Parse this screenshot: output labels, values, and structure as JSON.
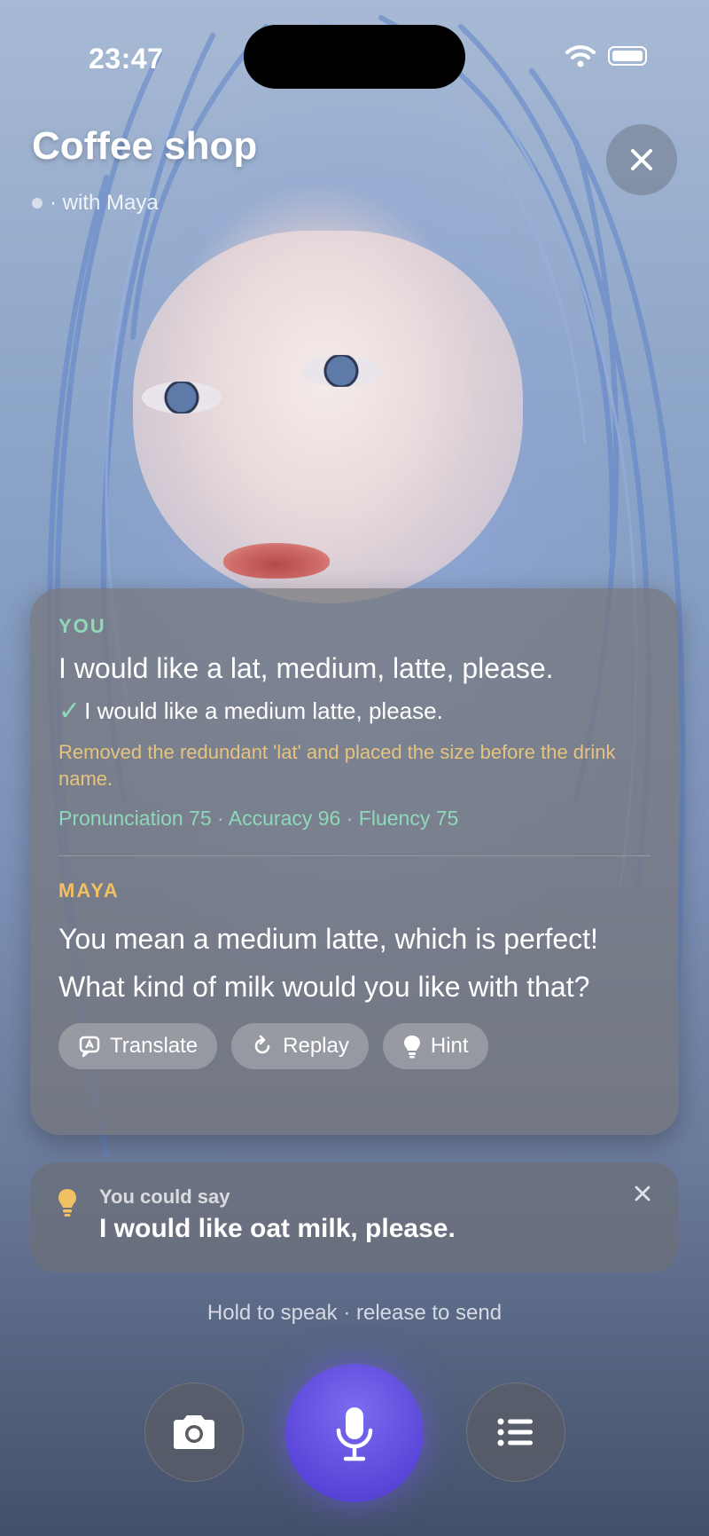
{
  "status_bar": {
    "time": "23:47"
  },
  "header": {
    "title": "Coffee shop",
    "subtitle": "· with Maya"
  },
  "conversation": {
    "you_label": "YOU",
    "you_text": "I would like a lat, medium, latte, please.",
    "corrected": "I would like a medium latte, please.",
    "explanation": "Removed the redundant 'lat' and placed the size before the drink name.",
    "scores": "Pronunciation 75 · Accuracy 96 · Fluency 75",
    "maya_label": "MAYA",
    "maya_text": "You mean a medium latte, which is perfect! What kind of milk would you like with that?",
    "actions": {
      "translate": "Translate",
      "replay": "Replay",
      "hint": "Hint"
    }
  },
  "hint": {
    "label": "You could say",
    "text": "I would like oat milk, please."
  },
  "footer": {
    "hold_text": "Hold to speak · release to send"
  },
  "colors": {
    "accent_green": "#8fd8b8",
    "accent_gold": "#f0c062",
    "mic_purple": "#5a46d8"
  }
}
